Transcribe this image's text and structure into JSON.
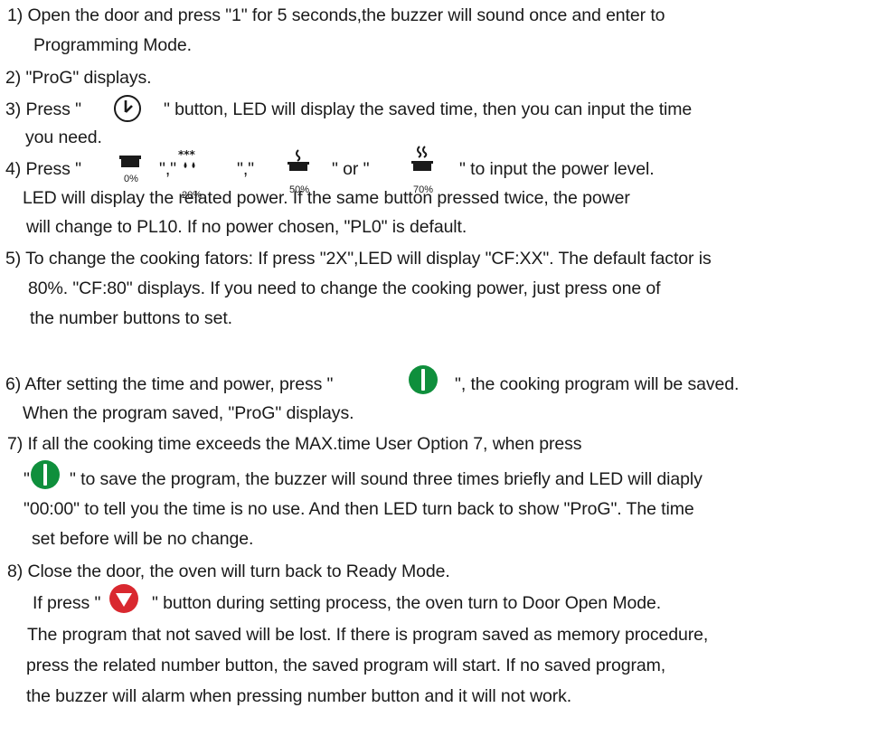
{
  "step1": {
    "line1": "1)  Open the door and press \"1\" for 5 seconds,the buzzer will sound once and enter to",
    "line2": "Programming Mode."
  },
  "step2": {
    "line1": "2) \"ProG\" displays."
  },
  "step3": {
    "line1a": "3) Press \"",
    "line1b": "\" button, LED will display the saved time, then you can input the time",
    "line2": "you need.",
    "icon": "clock-icon"
  },
  "step4": {
    "prefix": "4) Press \"",
    "sep1": "\",\"",
    "sep2": "\",\"",
    "sep3": "\" or \"",
    "suffix": "\" to input the power level.",
    "icons": [
      {
        "name": "pot-0-icon",
        "label": "0%"
      },
      {
        "name": "pot-defrost-icon",
        "label": "20%"
      },
      {
        "name": "pot-steam-low-icon",
        "label": "50%"
      },
      {
        "name": "pot-steam-high-icon",
        "label": "70%"
      }
    ],
    "line2": "LED will display the related power. If the same button pressed twice, the power",
    "line3": "will change to PL10. If no power chosen, \"PL0\" is default."
  },
  "step5": {
    "line1": "5) To change the cooking fators: If press \"2X\",LED will display \"CF:XX\". The default factor is",
    "line2": "80%. \"CF:80\" displays. If you need to change the cooking power, just press one of",
    "line3": "the number buttons to set."
  },
  "step6": {
    "line1a": "6) After setting the time and power, press \"",
    "line1b": "\", the cooking program will be saved.",
    "line2": "When the program saved, \"ProG\" displays.",
    "icon": "start-button-icon",
    "accent": "#0f8f3c"
  },
  "step7": {
    "line1": "7) If all the cooking time exceeds the MAX.time User Option 7, when press",
    "line2a": "\"",
    "line2b": "\" to save the program, the buzzer will sound three times briefly and LED will diaply",
    "line3": "\"00:00\" to tell you the time is no use. And then LED turn back to show \"ProG\". The time",
    "line4": "set before will be no change.",
    "icon": "start-button-icon"
  },
  "step8": {
    "line1": "8) Close the door, the oven will turn back to Ready Mode.",
    "line2a": "If press \"",
    "line2b": "\" button during setting process, the oven turn to Door Open Mode.",
    "line3": "The program that not saved will be lost. If there is program saved as memory procedure,",
    "line4": "press the related number button, the saved program will start. If no saved program,",
    "line5": "the buzzer will alarm when pressing number button and it will not work.",
    "icon": "stop-button-icon",
    "accent": "#d9282f"
  }
}
